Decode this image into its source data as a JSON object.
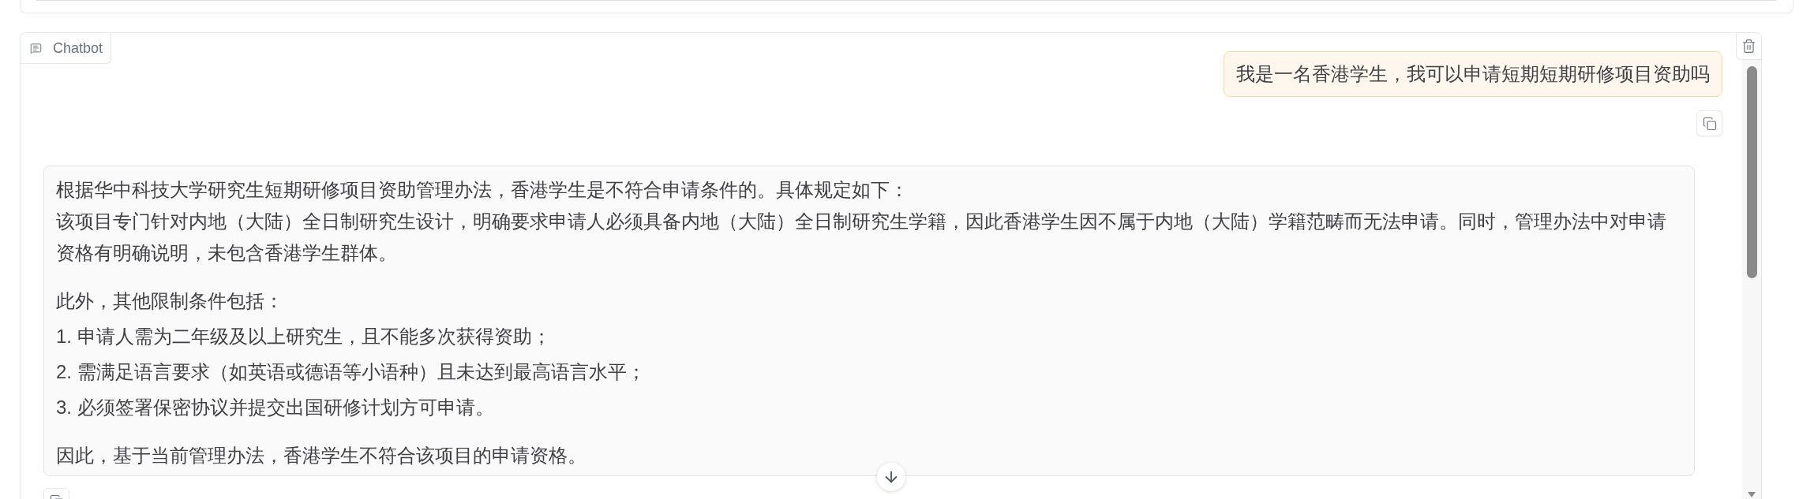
{
  "chatbot": {
    "label": "Chatbot",
    "messages": [
      {
        "kind": "user",
        "text": "我是一名香港学生，我可以申请短期短期研修项目资助吗"
      },
      {
        "kind": "bot",
        "blocks": [
          {
            "kind": "paragraph",
            "lines": [
              "根据华中科技大学研究生短期研修项目资助管理办法，香港学生是不符合申请条件的。具体规定如下：",
              "该项目专门针对内地（大陆）全日制研究生设计，明确要求申请人必须具备内地（大陆）全日制研究生学籍，因此香港学生因不属于内地（大陆）学籍范畴而无法申请。同时，管理办法中对申请资格有明确说明，未包含香港学生群体。"
            ]
          },
          {
            "kind": "paragraph",
            "lines": [
              "此外，其他限制条件包括："
            ]
          },
          {
            "kind": "list_item",
            "text": "1. 申请人需为二年级及以上研究生，且不能多次获得资助；"
          },
          {
            "kind": "list_item",
            "text": "2. 需满足语言要求（如英语或德语等小语种）且未达到最高语言水平；"
          },
          {
            "kind": "list_item",
            "text": "3. 必须签署保密协议并提交出国研修计划方可申请。"
          },
          {
            "kind": "paragraph",
            "lines": [
              "因此，基于当前管理办法，香港学生不符合该项目的申请资格。"
            ]
          }
        ]
      }
    ]
  }
}
